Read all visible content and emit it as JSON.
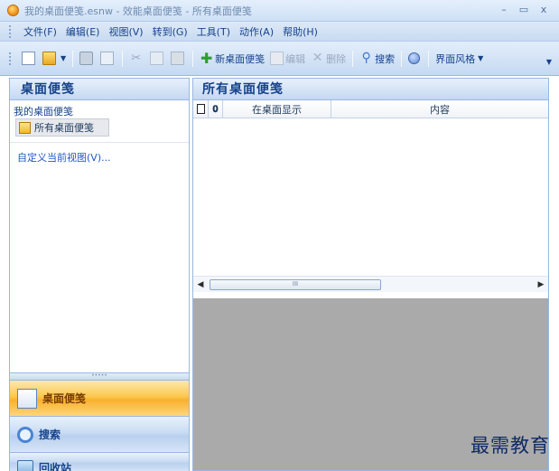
{
  "window": {
    "title": "我的桌面便笺.esnw - 效能桌面便笺 - 所有桌面便笺",
    "controls": [
      "–",
      "▭",
      "x"
    ]
  },
  "menu": {
    "items": [
      "文件(F)",
      "编辑(E)",
      "视图(V)",
      "转到(G)",
      "工具(T)",
      "动作(A)",
      "帮助(H)"
    ]
  },
  "toolbar": {
    "new_note": "新桌面便笺",
    "edit": "编辑",
    "delete": "删除",
    "search": "搜索",
    "theme": "界面风格"
  },
  "nav": {
    "header": "桌面便笺",
    "section_title": "我的桌面便笺",
    "selected_item": "所有桌面便笺",
    "custom_view_link": "自定义当前视图(V)...",
    "buttons": [
      {
        "label": "桌面便笺",
        "icon": "notes-icon",
        "active": true
      },
      {
        "label": "搜索",
        "icon": "search-icon",
        "active": false
      },
      {
        "label": "回收站",
        "icon": "recycle-bin-icon",
        "active": false
      }
    ]
  },
  "content": {
    "header": "所有桌面便笺",
    "columns": [
      "",
      "",
      "在桌面显示",
      "内容"
    ]
  },
  "watermark": "最需教育"
}
